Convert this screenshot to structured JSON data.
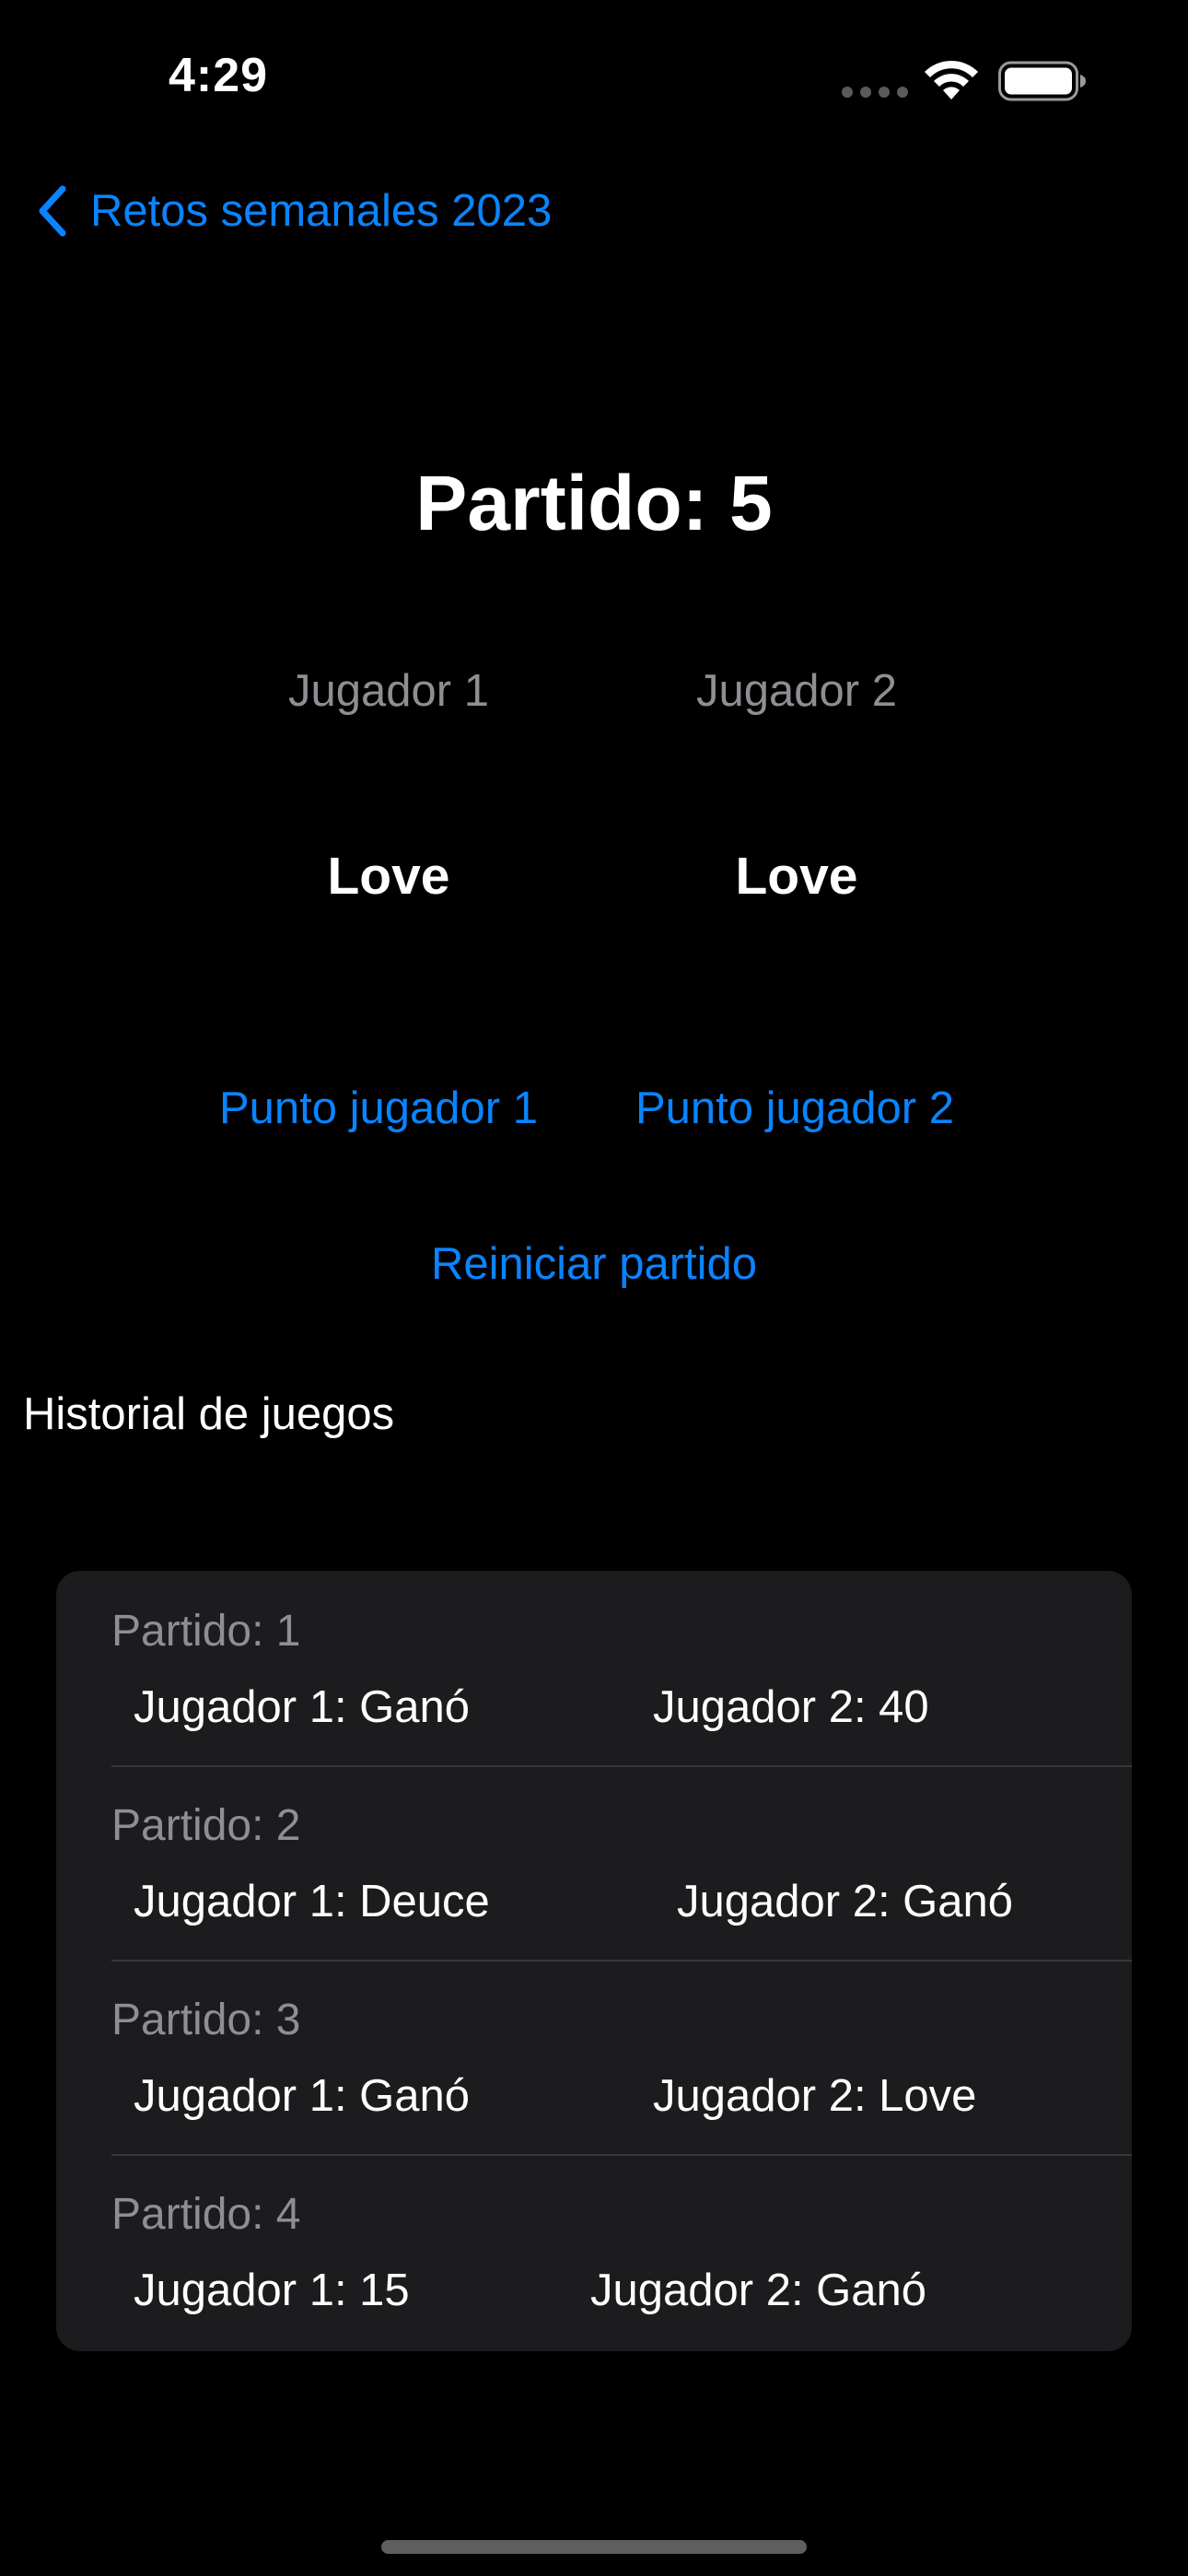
{
  "status_bar": {
    "time": "4:29",
    "icons": [
      "cellular-dots-icon",
      "wifi-icon",
      "battery-icon"
    ]
  },
  "nav": {
    "back_label": "Retos semanales 2023"
  },
  "match": {
    "title": "Partido: 5",
    "player1_label": "Jugador 1",
    "player2_label": "Jugador 2",
    "player1_score": "Love",
    "player2_score": "Love"
  },
  "actions": {
    "point_player1": "Punto jugador 1",
    "point_player2": "Punto jugador 2",
    "reset": "Reiniciar partido"
  },
  "history": {
    "heading": "Historial de juegos",
    "rows": [
      {
        "title": "Partido: 1",
        "player1": "Jugador 1: Ganó",
        "player2": "Jugador 2: 40"
      },
      {
        "title": "Partido: 2",
        "player1": "Jugador 1: Deuce",
        "player2": "Jugador 2: Ganó"
      },
      {
        "title": "Partido: 3",
        "player1": "Jugador 1: Ganó",
        "player2": "Jugador 2: Love"
      },
      {
        "title": "Partido: 4",
        "player1": "Jugador 1: 15",
        "player2": "Jugador 2: Ganó"
      }
    ]
  },
  "colors": {
    "background": "#000000",
    "accent": "#0a84ff",
    "secondary_text": "#8e8e93",
    "card_background": "#1c1c1e",
    "separator": "#38383a"
  }
}
